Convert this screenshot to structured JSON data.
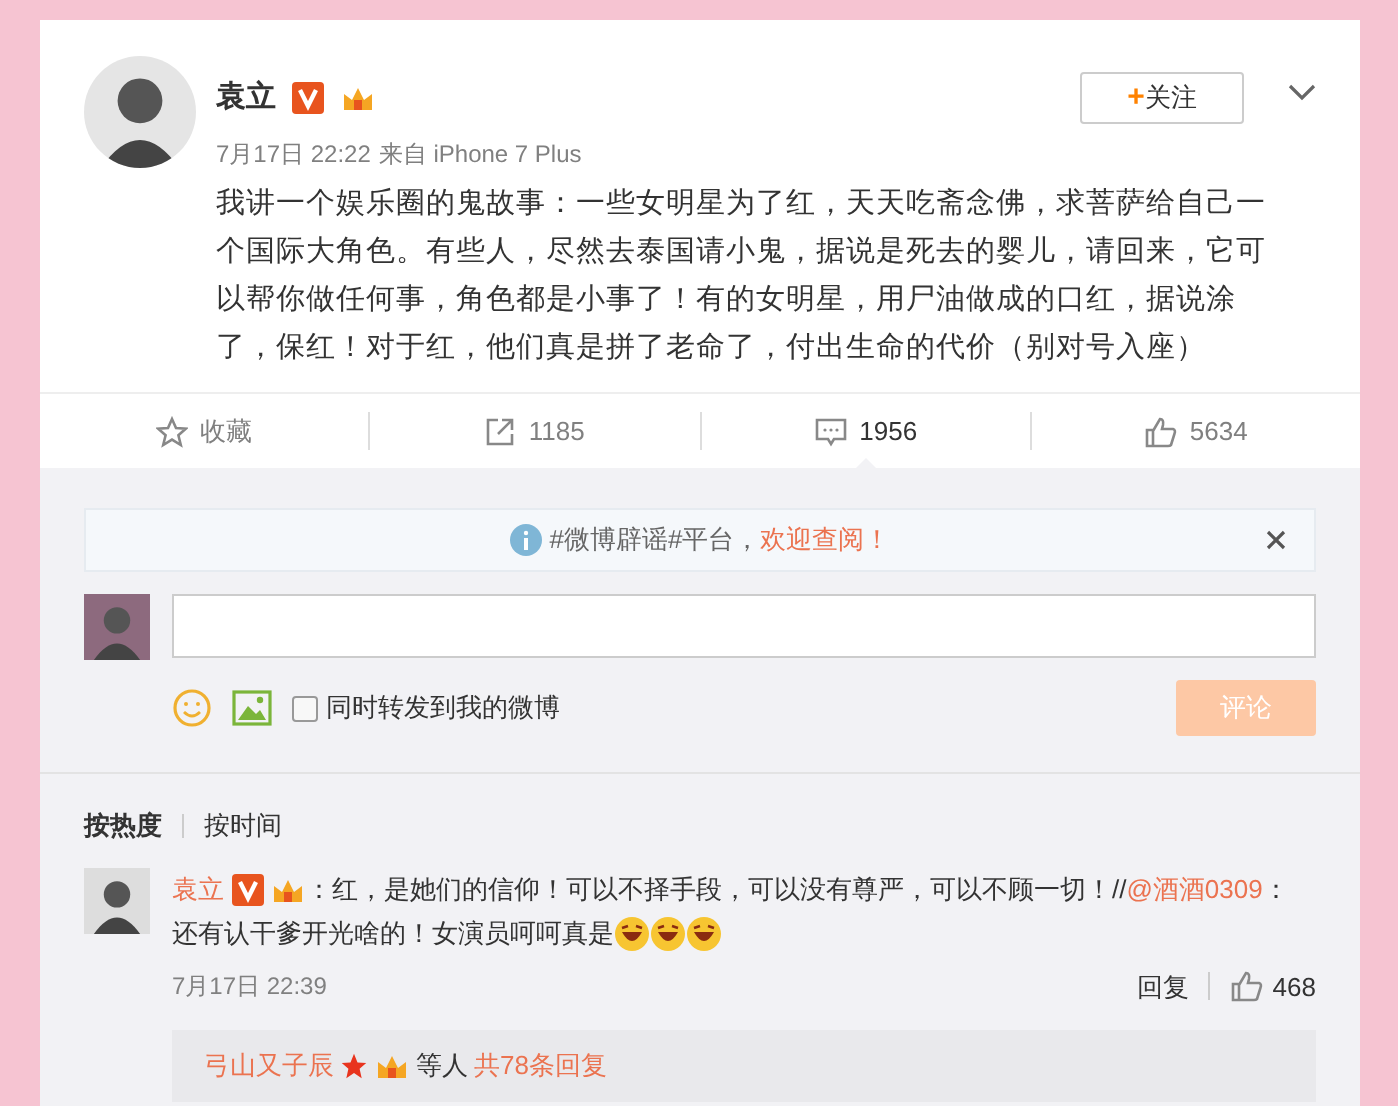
{
  "post": {
    "author": "袁立",
    "time": "7月17日 22:22",
    "source": "来自 iPhone 7 Plus",
    "follow": {
      "plus": "+",
      "label": "关注"
    },
    "text": "我讲一个娱乐圈的鬼故事：一些女明星为了红，天天吃斋念佛，求菩萨给自己一个国际大角色。有些人，尽然去泰国请小鬼，据说是死去的婴儿，请回来，它可以帮你做任何事，角色都是小事了！有的女明星，用尸油做成的口红，据说涂了，保红！对于红，他们真是拼了老命了，付出生命的代价（别对号入座）"
  },
  "actions": [
    {
      "kind": "favorite",
      "label": "收藏",
      "selected": false
    },
    {
      "kind": "repost",
      "label": "1185",
      "selected": false
    },
    {
      "kind": "comment",
      "label": "1956",
      "selected": true
    },
    {
      "kind": "like",
      "label": "5634",
      "selected": false
    }
  ],
  "notice": {
    "text": "#微博辟谣#平台，",
    "link": "欢迎查阅！"
  },
  "composer": {
    "repost_option": {
      "label": "同时转发到我的微博",
      "checked": false
    },
    "submit": {
      "label": "评论",
      "disabled": true
    }
  },
  "sort_tabs": [
    {
      "label": "按热度",
      "selected": true
    },
    {
      "label": "按时间",
      "selected": false
    }
  ],
  "comments": [
    {
      "author": "袁立",
      "text": "：红，是她们的信仰！可以不择手段，可以没有尊严，可以不顾一切！//",
      "mention": "@酒酒0309",
      "after_mention": "：",
      "second_line": "还有认干爹开光啥的！女演员呵呵真是",
      "time": "7月17日 22:39",
      "reply": "回复",
      "likes": "468",
      "replies": {
        "replier": "弓山又子辰",
        "others": "等人",
        "total": "共78条回复"
      }
    }
  ]
}
